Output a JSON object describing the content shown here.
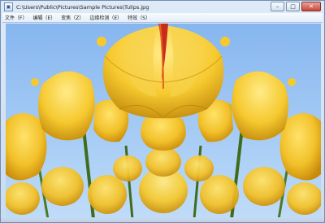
{
  "window": {
    "title": "C:\\Users\\Public\\Pictures\\Sample Pictures\\Tulips.jpg",
    "app_icon_glyph": "▣",
    "controls": {
      "minimize": "–",
      "maximize": "□",
      "close": "✕"
    }
  },
  "menu": {
    "items": [
      {
        "label": "文件（F）"
      },
      {
        "label": "编辑（E）"
      },
      {
        "label": "变焦（Z）"
      },
      {
        "label": "边缘检测（E）"
      },
      {
        "label": "特效（S）"
      }
    ]
  },
  "image": {
    "description": "tulips-photo-icon",
    "colors": {
      "sky": "#8fbaf0",
      "petal": "#f3c42b",
      "petal_shadow": "#c98a0b",
      "stem": "#3f6c1c",
      "accent": "#c72b1c"
    }
  }
}
